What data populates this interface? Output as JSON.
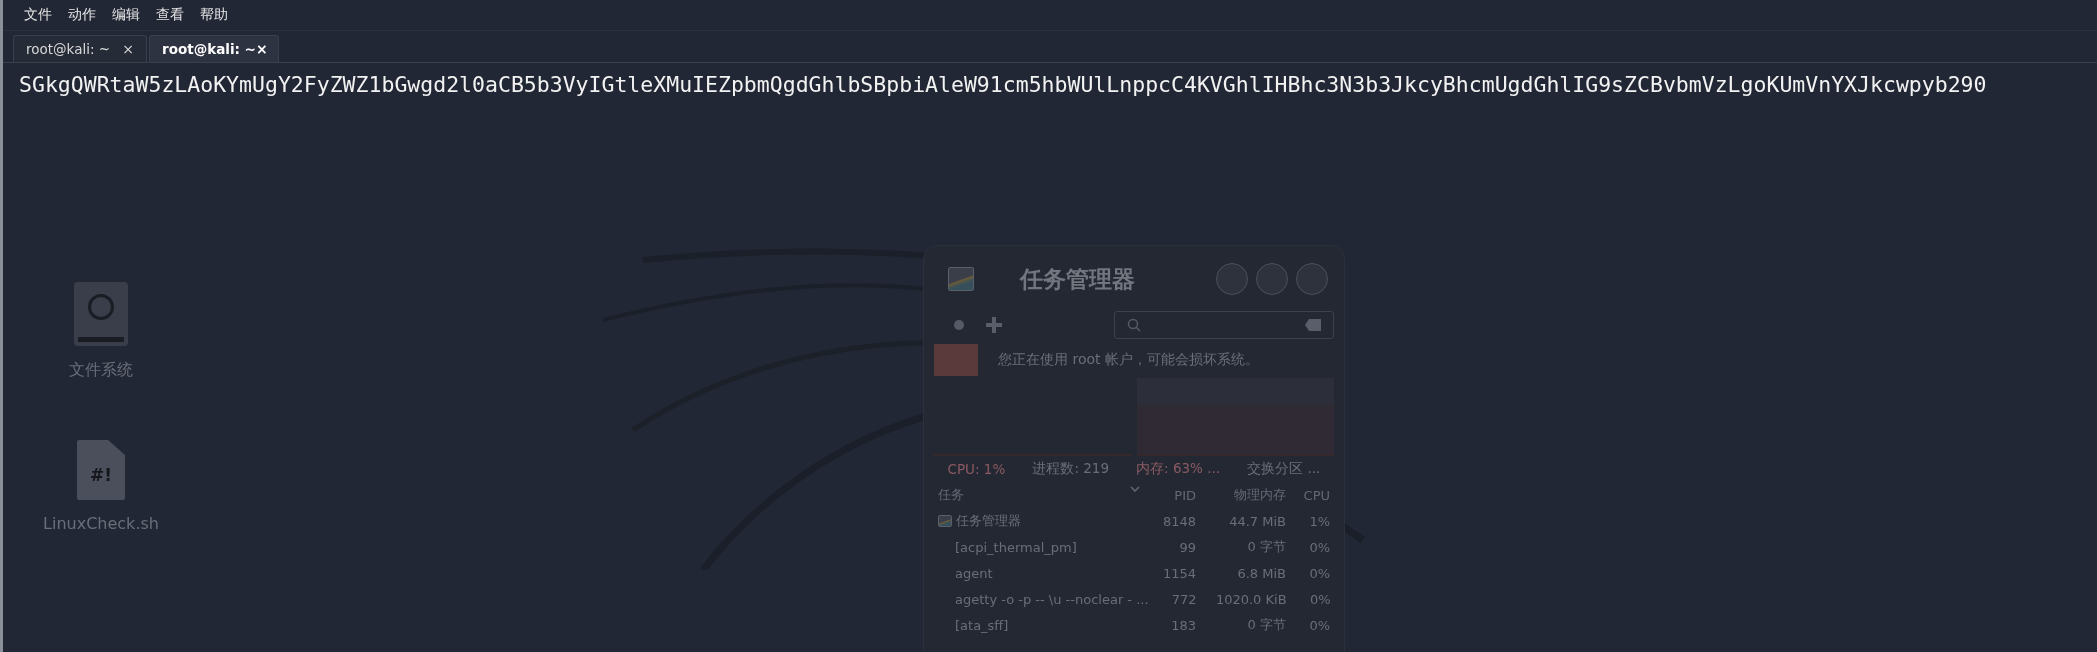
{
  "menu": [
    "文件",
    "动作",
    "编辑",
    "查看",
    "帮助"
  ],
  "tabs": [
    {
      "label": "root@kali: ~",
      "close": "×",
      "selected": false
    },
    {
      "label": "root@kali: ~",
      "close": "×",
      "selected": true
    }
  ],
  "terminal": {
    "lines": [
      "SGkgQWRtaW5zLAoKYmUgY2FyZWZ1bGwgd2l0aCB5b3VyIGtleXMuIEZpbmQgdGhlbSBpbiAleW91cm5hbWUlLnppcC4KVGhlIHBhc3N3b3JkcyBhcmUgdGhlIG9sZCBvbmVzLgoKUmVnYXJkcwpyb290"
    ]
  },
  "desktop": {
    "icons": [
      {
        "kind": "drive",
        "label": "文件系统"
      },
      {
        "kind": "script",
        "label": "LinuxCheck.sh",
        "glyph": "#!"
      }
    ],
    "task_manager": {
      "title": "任务管理器",
      "warning": "您正在使用 root 帐户，可能会损坏系统。",
      "stats": [
        {
          "text": "CPU: 1%",
          "kind": "alert"
        },
        {
          "text": "进程数: 219",
          "kind": "plain"
        },
        {
          "text": "内存: 63% ...",
          "kind": "alert"
        },
        {
          "text": "交换分区 ...",
          "kind": "plain"
        }
      ],
      "columns": [
        "任务",
        "PID",
        "物理内存",
        "CPU"
      ],
      "rows": [
        {
          "kind": "app",
          "task": "任务管理器",
          "pid": "8148",
          "memory": "44.7 MiB",
          "cpu": "1%"
        },
        {
          "kind": "process",
          "task": "[acpi_thermal_pm]",
          "pid": "99",
          "memory": "0 字节",
          "cpu": "0%"
        },
        {
          "kind": "process",
          "task": "agent",
          "pid": "1154",
          "memory": "6.8 MiB",
          "cpu": "0%"
        },
        {
          "kind": "process",
          "task": "agetty -o -p -- \\u --noclear - ...",
          "pid": "772",
          "memory": "1020.0 KiB",
          "cpu": "0%"
        },
        {
          "kind": "process",
          "task": "[ata_sff]",
          "pid": "183",
          "memory": "0 字节",
          "cpu": "0%"
        }
      ]
    }
  }
}
